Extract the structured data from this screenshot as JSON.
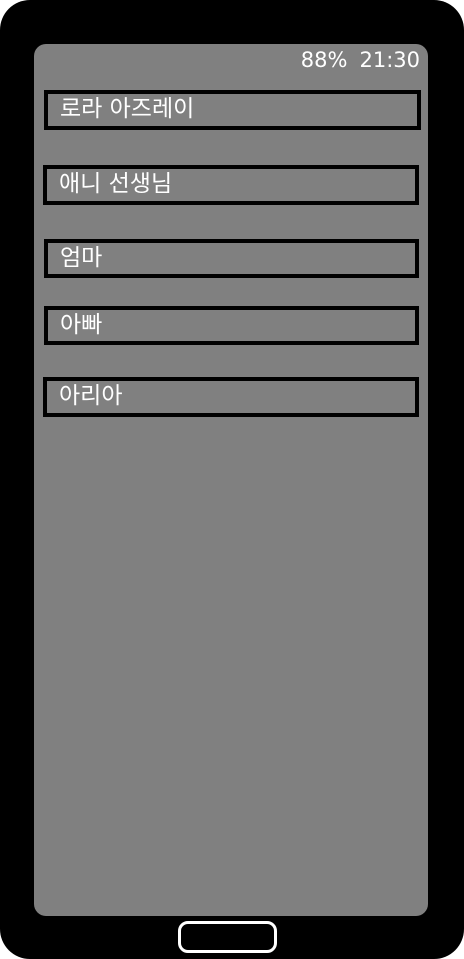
{
  "status_bar": {
    "battery": "88%",
    "time": "21:30"
  },
  "contacts": [
    {
      "name": "로라 아즈레이"
    },
    {
      "name": "애니 선생님"
    },
    {
      "name": "엄마"
    },
    {
      "name": "아빠"
    },
    {
      "name": "아리아"
    }
  ],
  "colors": {
    "frame": "#000000",
    "screen": "#808080",
    "text": "#ffffff"
  }
}
